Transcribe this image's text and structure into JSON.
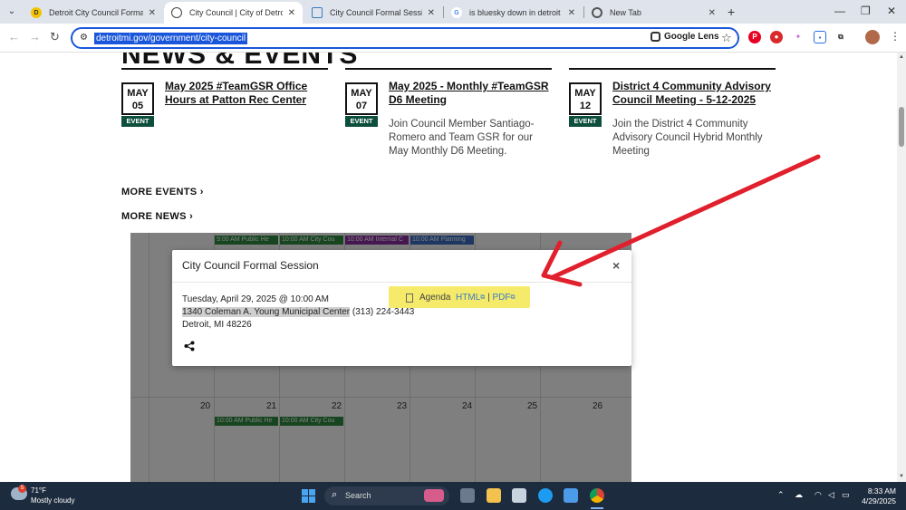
{
  "browser": {
    "tabs": [
      {
        "title": "Detroit City Council Formal Se...",
        "favicon": "D",
        "favicon_color": "#f4c400",
        "active": false
      },
      {
        "title": "City Council | City of Detroit",
        "favicon": "seal",
        "favicon_color": "#444444",
        "active": true
      },
      {
        "title": "City Council Formal Session - A...",
        "favicon": "doc",
        "favicon_color": "#3b7bc4",
        "active": false
      },
      {
        "title": "is bluesky down in detroit toda...",
        "favicon": "G",
        "favicon_color": "#4285f4",
        "active": false
      },
      {
        "title": "New Tab",
        "favicon": "chrome",
        "favicon_color": "#555555",
        "active": false
      }
    ],
    "url": "detroitmi.gov/government/city-council",
    "lens_label": "Google Lens"
  },
  "page": {
    "heading_cut": "NEWS & EVENTS",
    "events": [
      {
        "month": "MAY",
        "day": "05",
        "tag": "EVENT",
        "title": "May 2025 #TeamGSR Office Hours at Patton Rec Center",
        "desc": ""
      },
      {
        "month": "MAY",
        "day": "07",
        "tag": "EVENT",
        "title": "May 2025 - Monthly #TeamGSR D6 Meeting",
        "desc": "Join Council Member Santiago-Romero and Team GSR for our May Monthly D6 Meeting."
      },
      {
        "month": "MAY",
        "day": "12",
        "tag": "EVENT",
        "title": "District 4 Community Advisory Council Meeting - 5-12-2025",
        "desc": "Join the District 4 Community Advisory Council  Hybrid Monthly Meeting"
      }
    ],
    "more_events": "MORE EVENTS",
    "more_news": "MORE NEWS",
    "calendar": {
      "top_events": [
        {
          "text": "9:00 AM Public He",
          "color": "#2e8b3e"
        },
        {
          "text": "10:00 AM City Cou",
          "color": "#2e8b3e"
        },
        {
          "text": "10:00 AM Internal C",
          "color": "#8b2fa0"
        },
        {
          "text": "10:00 AM Planning",
          "color": "#3b6fc4"
        }
      ],
      "week_days": [
        "20",
        "21",
        "22",
        "23",
        "24",
        "25",
        "26"
      ],
      "bottom_events": [
        {
          "text": "10:00 AM Public He",
          "color": "#2e8b3e"
        },
        {
          "text": "10:00 AM City Cou",
          "color": "#2e8b3e"
        }
      ]
    },
    "modal": {
      "title": "City Council Formal Session",
      "datetime": "Tuesday, April 29, 2025 @ 10:00 AM",
      "address_highlighted": "1340 Coleman A. Young Municipal Center",
      "phone": " (313) 224-3443",
      "city": "Detroit, MI 48226",
      "agenda_label": "Agenda",
      "agenda_html": "HTML",
      "agenda_sep": "|",
      "agenda_pdf": "PDF",
      "close": "×"
    },
    "annotation_color": "#e0202c",
    "highlight_color": "#f5ea6a"
  },
  "taskbar": {
    "badge": "5",
    "temp": "71°F",
    "condition": "Mostly cloudy",
    "search_label": "Search",
    "time": "8:33 AM",
    "date": "4/29/2025"
  }
}
